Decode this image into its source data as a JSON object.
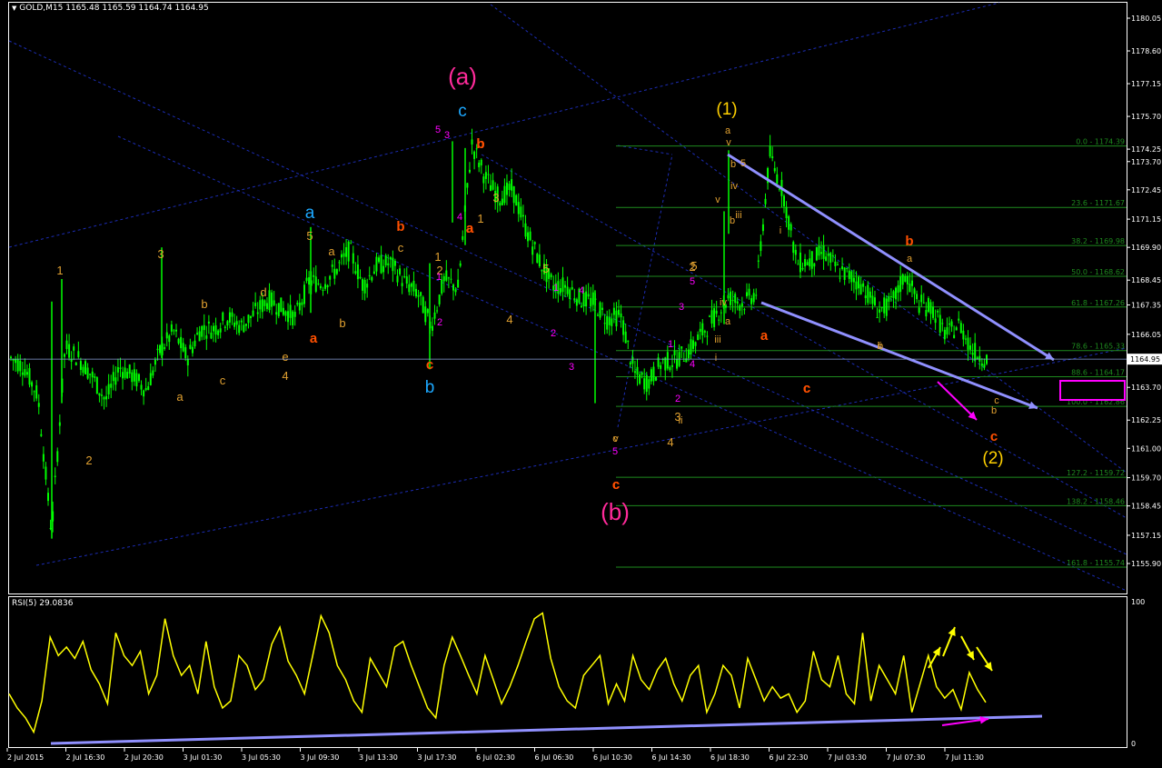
{
  "header": {
    "symbol": "GOLD,M15",
    "ohlc": "1165.48 1165.59 1164.74 1164.95",
    "rsi_label": "RSI(5) 29.0836"
  },
  "colors": {
    "background": "#000000",
    "candle": "#00ff00",
    "grid_border": "#ffffff",
    "channel_dotted": "#1c2cb3",
    "trend_arrow": "#9090ff",
    "fib": "#1e8a1e",
    "rsi_line": "#ffff00",
    "magenta": "#ff00ff",
    "pink_label": "#ff2a9a",
    "cyan_label": "#1ca8ff",
    "orange_label": "#ff5000",
    "yellow_label": "#ffd000",
    "gold_label": "#e0a030"
  },
  "chart_data": [
    {
      "type": "candlestick",
      "title": "GOLD,M15",
      "ylim": [
        1155.9,
        1180.1
      ],
      "y_ticks": [
        "1180.05",
        "1178.60",
        "1177.15",
        "1175.70",
        "1174.25",
        "1173.70",
        "1172.45",
        "1171.15",
        "1169.90",
        "1168.45",
        "1167.35",
        "1166.05",
        "1164.95",
        "1163.70",
        "1162.25",
        "1161.00",
        "1159.70",
        "1158.45",
        "1157.15",
        "1155.90"
      ],
      "current_price": "1164.95",
      "x_ticks": [
        "2 Jul 2015",
        "2 Jul 16:30",
        "2 Jul 20:30",
        "3 Jul 01:30",
        "3 Jul 05:30",
        "3 Jul 09:30",
        "3 Jul 13:30",
        "3 Jul 17:30",
        "6 Jul 02:30",
        "6 Jul 06:30",
        "6 Jul 10:30",
        "6 Jul 14:30",
        "6 Jul 18:30",
        "6 Jul 22:30",
        "7 Jul 03:30",
        "7 Jul 07:30",
        "7 Jul 11:30"
      ],
      "close_path": [
        1165.0,
        1164.6,
        1163.3,
        1157.2,
        1165.5,
        1165.0,
        1164.2,
        1163.1,
        1164.6,
        1164.2,
        1163.6,
        1165.3,
        1166.2,
        1165.0,
        1166.3,
        1166.3,
        1166.8,
        1166.4,
        1167.0,
        1167.6,
        1167.2,
        1166.8,
        1168.4,
        1168.3,
        1168.9,
        1169.8,
        1168.2,
        1169.1,
        1169.2,
        1168.4,
        1167.9,
        1166.4,
        1168.5,
        1168.1,
        1174.5,
        1173.0,
        1172.1,
        1172.5,
        1170.7,
        1169.3,
        1168.2,
        1168.2,
        1167.6,
        1167.5,
        1166.7,
        1166.9,
        1164.3,
        1163.9,
        1164.8,
        1164.9,
        1165.3,
        1166.1,
        1166.9,
        1167.7,
        1167.4,
        1167.9,
        1174.0,
        1172.3,
        1169.2,
        1169.3,
        1169.7,
        1168.9,
        1168.6,
        1168.1,
        1167.1,
        1167.4,
        1168.7,
        1167.4,
        1167.2,
        1166.0,
        1166.5,
        1165.3,
        1164.95
      ],
      "fibonacci": [
        {
          "label": "0.0 - 1174.39",
          "level": 1174.39
        },
        {
          "label": "23.6 - 1171.67",
          "level": 1171.67
        },
        {
          "label": "38.2 - 1169.98",
          "level": 1169.98
        },
        {
          "label": "50.0 - 1168.62",
          "level": 1168.62
        },
        {
          "label": "61.8 - 1167.26",
          "level": 1167.26
        },
        {
          "label": "78.6 - 1165.33",
          "level": 1165.33
        },
        {
          "label": "88.6 - 1164.17",
          "level": 1164.17
        },
        {
          "label": "100.0 - 1162.86",
          "level": 1162.86
        },
        {
          "label": "127.2 - 1159.72",
          "level": 1159.72
        },
        {
          "label": "138.2 - 1158.46",
          "level": 1158.46
        },
        {
          "label": "161.8 - 1155.74",
          "level": 1155.74
        }
      ],
      "wave_labels": {
        "pink": [
          "(a)",
          "(b)"
        ],
        "yellow": [
          "(1)",
          "(2)"
        ],
        "cyan": [
          "a",
          "c",
          "b"
        ],
        "orange": [
          "b",
          "a",
          "c",
          "b",
          "a",
          "c",
          "b",
          "a",
          "c",
          "b",
          "c",
          "a",
          "c",
          "c"
        ],
        "gold": [
          "1",
          "2",
          "3",
          "a",
          "b",
          "c",
          "d",
          "e",
          "4",
          "5",
          "a",
          "b",
          "c",
          "1",
          "2",
          "3",
          "4",
          "5",
          "1",
          "2",
          "3",
          "4",
          "5",
          "i",
          "ii",
          "iii",
          "iv",
          "v",
          "a",
          "b",
          "c",
          "5",
          "v",
          "b",
          "iii",
          "iv",
          "a",
          "i",
          "ii",
          "a",
          "b",
          "c",
          "b",
          "v"
        ],
        "magenta": [
          "1",
          "2",
          "3",
          "4",
          "5",
          "1",
          "2",
          "3",
          "4",
          "5",
          "1",
          "2",
          "3",
          "4",
          "5"
        ]
      }
    },
    {
      "type": "line",
      "title": "RSI(5) 29.0836",
      "ylim": [
        0,
        100
      ],
      "y_ticks": [
        "100",
        "0"
      ],
      "values": [
        35,
        25,
        18,
        8,
        30,
        75,
        62,
        68,
        60,
        72,
        52,
        42,
        28,
        78,
        62,
        55,
        65,
        35,
        48,
        88,
        62,
        48,
        55,
        35,
        72,
        40,
        25,
        30,
        62,
        55,
        38,
        45,
        70,
        82,
        58,
        48,
        35,
        62,
        90,
        78,
        55,
        45,
        30,
        22,
        60,
        50,
        40,
        68,
        72,
        55,
        40,
        25,
        18,
        55,
        75,
        62,
        48,
        35,
        62,
        45,
        28,
        40,
        55,
        72,
        88,
        92,
        60,
        40,
        30,
        25,
        48,
        55,
        62,
        28,
        42,
        30,
        62,
        45,
        38,
        52,
        60,
        42,
        30,
        48,
        55,
        22,
        35,
        55,
        48,
        25,
        60,
        45,
        30,
        40,
        32,
        35,
        22,
        30,
        65,
        45,
        40,
        62,
        35,
        28,
        78,
        30,
        55,
        45,
        35,
        62,
        22,
        42,
        62,
        40,
        32,
        38,
        24,
        50,
        38,
        29
      ]
    }
  ]
}
